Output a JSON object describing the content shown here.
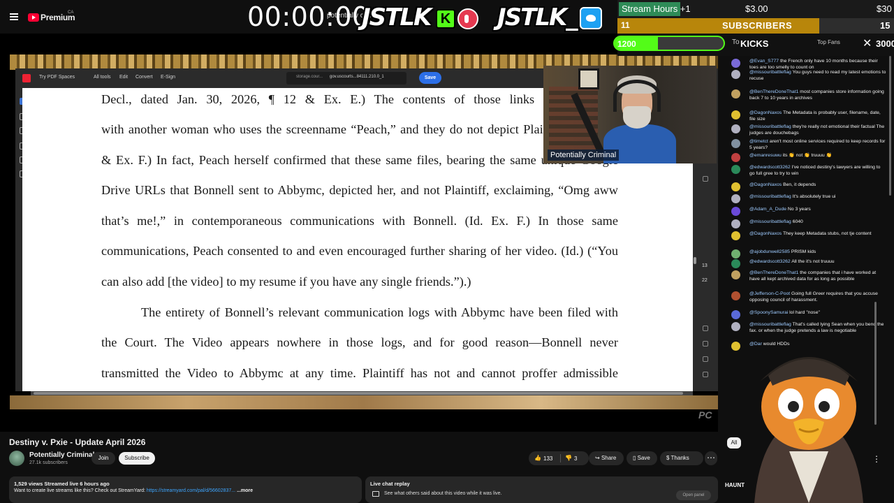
{
  "youtube": {
    "logo_text": "Premium",
    "region": "CA"
  },
  "overlay": {
    "timer": "00:00:00",
    "timer_sub": "potentially crim",
    "brand1": "JSTLK",
    "brand2": "JSTLK_",
    "kick_letter": "K"
  },
  "stats": {
    "stream_hours": "Stream Hours +1",
    "money_current": "$3.00",
    "money_goal": "$30",
    "subscribers_current": "11",
    "subscribers_label": "SUBSCRIBERS",
    "subscribers_goal": "15",
    "subscribers_progress": 0.73,
    "kicks_current": "1200",
    "kicks_label": "KICKS",
    "kicks_goal": "3000",
    "kicks_progress": 0.4,
    "today_label": "To",
    "top_fans": "Top Fans",
    "close": "✕"
  },
  "pdf": {
    "toolbar": {
      "try_spaces": "Try PDF Spaces",
      "all_tools": "All tools",
      "edit": "Edit",
      "convert": "Convert",
      "esign": "E-Sign",
      "url_a": "storage.cour...",
      "url_b": "gov.uscourts...84111.210.0_1",
      "save": "Save"
    },
    "page_numbers": [
      "13",
      "22"
    ],
    "lines": [
      "Decl., dated Jan. 30, 2026, ¶ 12 & Ex. E.) The contents of those links contain video",
      "with another woman who uses the screenname “Peach,” and they do not depict Plaintiff. (Id. ¶ 12",
      "& Ex. F.) In fact, Peach herself confirmed that these same files, bearing the same unique Google",
      "Drive URLs that Bonnell sent to Abbymc, depicted her, and not Plaintiff, exclaiming, “Omg aww",
      "that’s me!,” in contemporaneous communications with Bonnell. (Id. Ex. F.) In those same",
      "communications, Peach consented to and even encouraged further sharing of her video. (Id.) (“You",
      "can also add [the video] to my resume if you have any single friends.”).)",
      "The entirety of Bonnell’s relevant communication logs with Abbymc have been filed with",
      "the Court. The Video appears nowhere in those logs, and for good reason—Bonnell never",
      "transmitted the Video to Abbymc at any time. Plaintiff has not and cannot proffer admissible"
    ]
  },
  "webcam": {
    "label": "Potentially Criminal"
  },
  "watermark": "PC",
  "video": {
    "title": "Destiny v. Pxie - Update April 2026",
    "channel": "Potentially Criminal",
    "subscribers": "27.1k subscribers",
    "join": "Join",
    "subscribe": "Subscribe",
    "likes": "133",
    "dislikes": "3",
    "share": "Share",
    "save": "Save",
    "thanks": "Thanks",
    "more": "⋯",
    "meta": "1,529 views  Streamed live 6 hours ago",
    "desc_prefix": "Want to create live streams like this? Check out StreamYard: ",
    "desc_link": "https://streamyard.com/pal/d/56602837...",
    "desc_more": "...more",
    "replay_title": "Live chat replay",
    "replay_text": "See what others said about this video while it was live.",
    "open_panel": "Open panel"
  },
  "chat": {
    "all_chip": "All",
    "haunt": "HAUNT",
    "messages": [
      {
        "name": "@Evan_S777",
        "text": "the French only have 10 months because their toes are too smelly to count on",
        "color": "#7a6ad8"
      },
      {
        "name": "@missouribattleflag",
        "text": "You guys need to read my latest emotions to recuse",
        "color": "#b0b0c0"
      },
      {
        "name": "@BenThereDoneThat1",
        "text": "most companies store information going back 7 to 10 years in archives",
        "color": "#c0a060"
      },
      {
        "name": "@DagonNaxos",
        "text": "The Metadata is probably user, filename, date, file size",
        "color": "#e0c030"
      },
      {
        "name": "@missouribattleflag",
        "text": "they're really not emotional their factual The judges are douchebags",
        "color": "#b0b0c0"
      },
      {
        "name": "@timetct",
        "text": "aren't most online services required to keep records for 5 years?",
        "color": "#8090a0"
      },
      {
        "name": "@emanresuwu",
        "text": "its 👏 not 👏 truuuu 👏",
        "color": "#c04040"
      },
      {
        "name": "@edwardscott3262",
        "text": "I've noticed destiny's lawyers are willing to go full gree to try to win",
        "color": "#2a8a5a"
      },
      {
        "name": "@DagonNaxos",
        "text": "Ben, it depends",
        "color": "#e0c030"
      },
      {
        "name": "@missouribattleflag",
        "text": "It's absolutely true ui",
        "color": "#b0b0c0"
      },
      {
        "name": "@Adam_A_Dude",
        "text": "No 3 years",
        "color": "#6a4ad8"
      },
      {
        "name": "@missouribattleflag",
        "text": "6040",
        "color": "#b0b0c0"
      },
      {
        "name": "@DagonNaxos",
        "text": "They keep Metadata stubs, not tje content",
        "color": "#e0c030"
      },
      {
        "name": "@ajobdunwell2585",
        "text": "PRISM kids",
        "color": "#70b070"
      },
      {
        "name": "@edwardscott3262",
        "text": "All the it's not truuuu",
        "color": "#2a8a5a"
      },
      {
        "name": "@BenThereDoneThat1",
        "text": "the companies that i have worked at have all kept archived data for as long as possible",
        "color": "#c0a060"
      },
      {
        "name": "@Jefferson-C-Poot",
        "text": "Going full Greer requires that you accuse opposing council of harassment.",
        "color": "#b05030"
      },
      {
        "name": "@SpoonySamurai",
        "text": "lol hard \"nose\"",
        "color": "#5a6ad8"
      },
      {
        "name": "@missouribattleflag",
        "text": "That's called lying Sean when you bend the fax. or when the judge pretends a law is negotiable",
        "color": "#b0b0c0"
      },
      {
        "name": "@Dar",
        "text": "would HDDs",
        "color": "#e0c030"
      }
    ]
  }
}
